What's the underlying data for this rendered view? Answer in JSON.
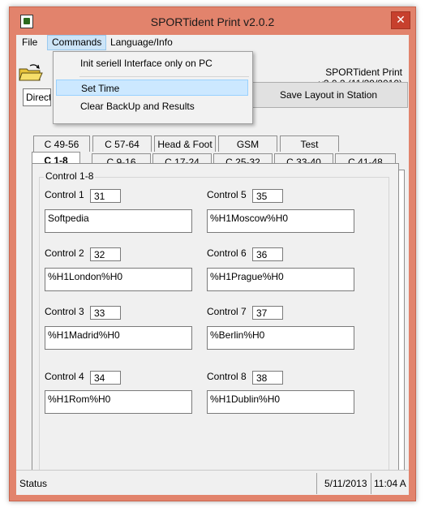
{
  "window": {
    "title": "SPORTident Print v2.0.2",
    "close_glyph": "✕"
  },
  "menubar": {
    "items": [
      "File",
      "Commands",
      "Language/Info"
    ]
  },
  "dropdown": {
    "items": [
      "Init seriell Interface only on PC",
      "Set Time",
      "Clear BackUp and Results"
    ]
  },
  "header": {
    "app_name": "SPORTident Print",
    "version": "v2.0.2 (11/29/2010)"
  },
  "combo": {
    "value": "Direct"
  },
  "toolbar": {
    "save_layout_label": "Save Layout in Station"
  },
  "tabs_back": [
    "C 49-56",
    "C 57-64",
    "Head & Foot",
    "GSM",
    "Test"
  ],
  "tabs_front": [
    "C 1-8",
    "C 9-16",
    "C 17-24",
    "C 25-32",
    "C 33-40",
    "C 41-48"
  ],
  "group": {
    "label": "Control 1-8"
  },
  "controls": [
    {
      "label": "Control 1",
      "number": "31",
      "text": "Softpedia"
    },
    {
      "label": "Control 2",
      "number": "32",
      "text": "%H1London%H0"
    },
    {
      "label": "Control 3",
      "number": "33",
      "text": "%H1Madrid%H0"
    },
    {
      "label": "Control 4",
      "number": "34",
      "text": "%H1Rom%H0"
    },
    {
      "label": "Control 5",
      "number": "35",
      "text": "%H1Moscow%H0"
    },
    {
      "label": "Control 6",
      "number": "36",
      "text": "%H1Prague%H0"
    },
    {
      "label": "Control 7",
      "number": "37",
      "text": "%Berlin%H0"
    },
    {
      "label": "Control 8",
      "number": "38",
      "text": "%H1Dublin%H0"
    }
  ],
  "status": {
    "label": "Status",
    "date": "5/11/2013",
    "time": "11:04 A"
  },
  "colors": {
    "title_bar": "#e2836c",
    "close_button": "#c7402d",
    "menu_highlight": "#cce4f7",
    "dropdown_hover": "#cce8ff"
  }
}
